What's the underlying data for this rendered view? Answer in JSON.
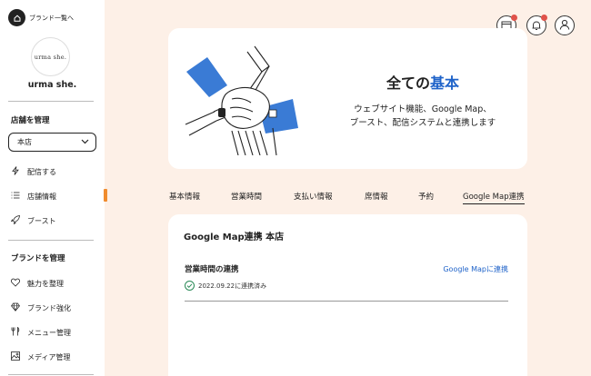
{
  "sidebar": {
    "back_label": "ブランド一覧へ",
    "logo_text": "urma she.",
    "brand_name": "urma she.",
    "store_section_title": "店舗を管理",
    "store_select_value": "本店",
    "store_items": [
      {
        "label": "配信する",
        "icon": "lightning-icon"
      },
      {
        "label": "店舗情報",
        "icon": "list-icon"
      },
      {
        "label": "ブースト",
        "icon": "rocket-icon"
      }
    ],
    "brand_section_title": "ブランドを管理",
    "brand_items": [
      {
        "label": "魅力を整理",
        "icon": "heart-icon"
      },
      {
        "label": "ブランド強化",
        "icon": "diamond-icon"
      },
      {
        "label": "メニュー管理",
        "icon": "cutlery-icon"
      },
      {
        "label": "メディア管理",
        "icon": "image-icon"
      }
    ],
    "active_accent": "#f08c2e"
  },
  "header_icons": [
    "calendar-icon",
    "bell-icon",
    "user-icon"
  ],
  "hero": {
    "title_prefix": "全ての",
    "title_accent": "基本",
    "subtitle_line1": "ウェブサイト機能、Google Map、",
    "subtitle_line2": "ブースト、配信システムと連携します",
    "accent_color": "#1f63c9"
  },
  "tabs": [
    {
      "label": "基本情報",
      "active": false
    },
    {
      "label": "営業時間",
      "active": false
    },
    {
      "label": "支払い情報",
      "active": false
    },
    {
      "label": "席情報",
      "active": false
    },
    {
      "label": "予約",
      "active": false
    },
    {
      "label": "Google Map連携",
      "active": true
    }
  ],
  "card": {
    "title": "Google Map連携 本店",
    "row_label": "営業時間の連携",
    "row_link": "Google Mapに連携",
    "status_text": "2022.09.22に連携済み"
  }
}
